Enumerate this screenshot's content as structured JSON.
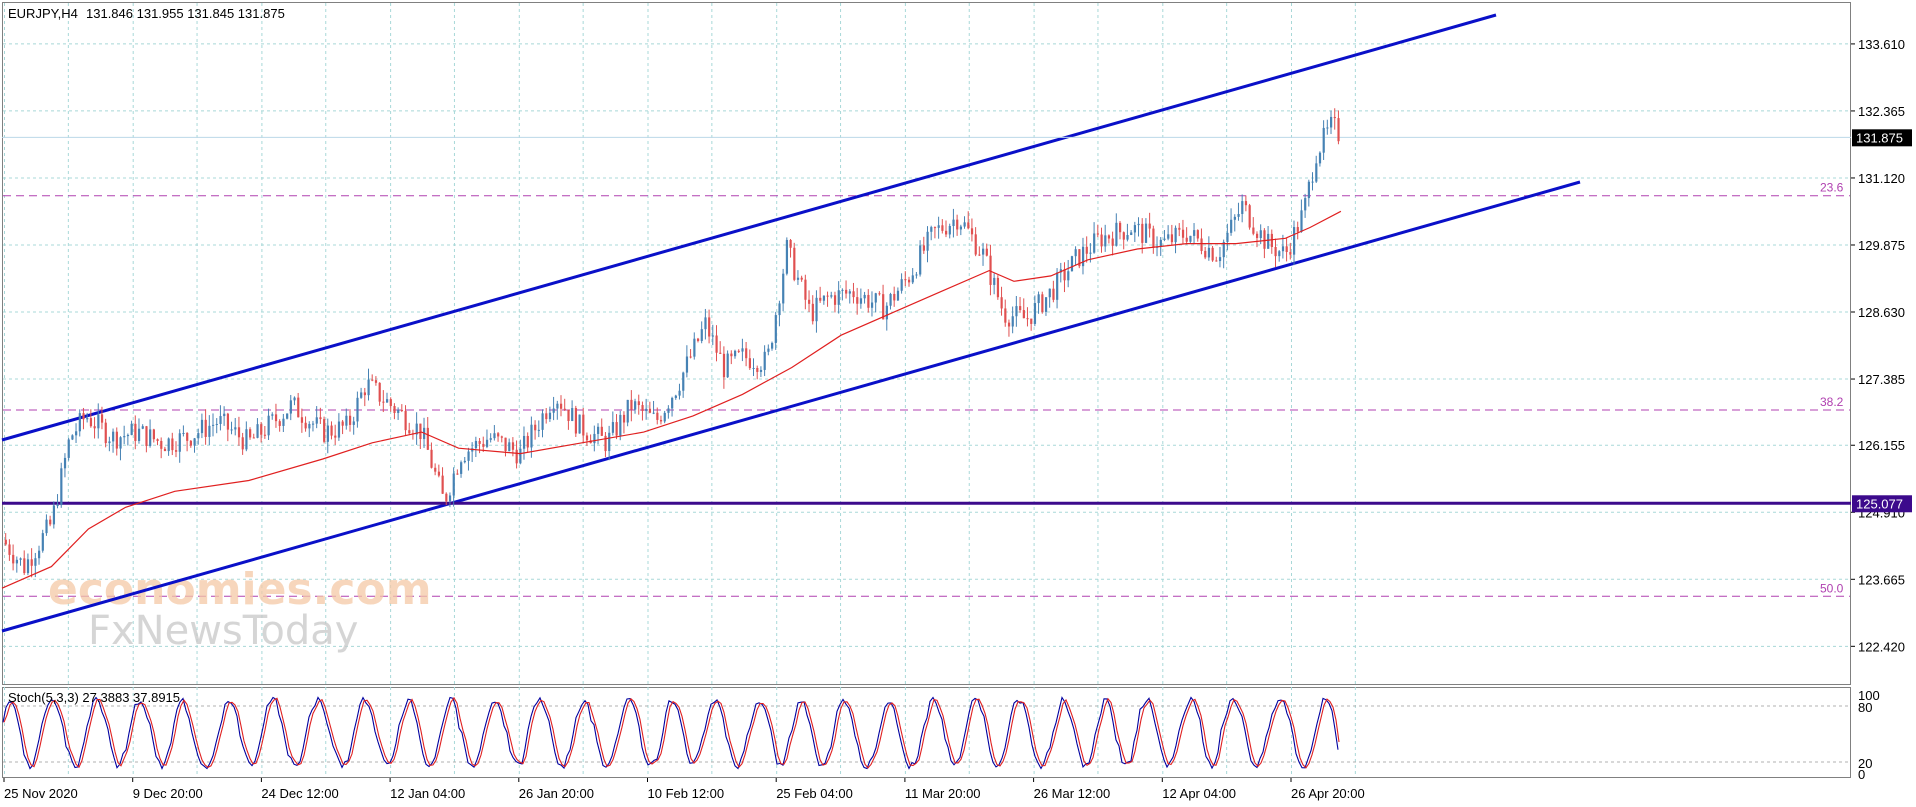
{
  "header": {
    "symbol": "EURJPY,H4",
    "ohlc": "131.846 131.955 131.845 131.875"
  },
  "indicator": {
    "label": "Stoch(5,3,3) 27.3883 37.8915",
    "levels": [
      "100",
      "80",
      "20",
      "0"
    ]
  },
  "watermark": {
    "line1": "economies.com",
    "line2": "FxNewsToday"
  },
  "colors": {
    "bull": "#4682b4",
    "bear": "#e05050",
    "ma": "#e02020",
    "channel": "#0a10c8",
    "support": "#3c0a8c",
    "fib": "#b040b0",
    "grid": "#a8d8d8",
    "stoch_main": "#0000a0",
    "stoch_signal": "#e02020"
  },
  "chart_data": {
    "type": "candlestick",
    "symbol": "EURJPY",
    "timeframe": "H4",
    "price_axis_ticks": [
      "133.610",
      "132.365",
      "131.120",
      "129.875",
      "128.630",
      "127.385",
      "126.155",
      "124.910",
      "123.665",
      "122.420"
    ],
    "ylim": [
      121.72,
      134.37
    ],
    "last_price": "131.875",
    "support_line": {
      "price": 125.077,
      "label": "125.077"
    },
    "fib_levels": [
      {
        "label": "23.6",
        "price": 130.79
      },
      {
        "label": "38.2",
        "price": 126.81
      },
      {
        "label": "50.0",
        "price": 123.35
      }
    ],
    "time_labels": [
      "25 Nov 2020",
      "9 Dec 20:00",
      "24 Dec 12:00",
      "12 Jan 04:00",
      "26 Jan 20:00",
      "10 Feb 12:00",
      "25 Feb 04:00",
      "11 Mar 20:00",
      "26 Mar 12:00",
      "12 Apr 04:00",
      "26 Apr 20:00"
    ],
    "price_path": [
      [
        0,
        124.4
      ],
      [
        18,
        123.9
      ],
      [
        40,
        124.7
      ],
      [
        55,
        126.3
      ],
      [
        68,
        126.7
      ],
      [
        90,
        126.3
      ],
      [
        110,
        126.4
      ],
      [
        130,
        126.2
      ],
      [
        150,
        126.3
      ],
      [
        175,
        126.6
      ],
      [
        200,
        126.2
      ],
      [
        235,
        126.9
      ],
      [
        260,
        126.4
      ],
      [
        280,
        126.5
      ],
      [
        295,
        127.3
      ],
      [
        320,
        126.8
      ],
      [
        340,
        126.4
      ],
      [
        358,
        125.1
      ],
      [
        372,
        126.0
      ],
      [
        395,
        126.3
      ],
      [
        420,
        126.0
      ],
      [
        448,
        127.1
      ],
      [
        468,
        126.5
      ],
      [
        490,
        126.2
      ],
      [
        510,
        126.9
      ],
      [
        530,
        126.6
      ],
      [
        548,
        127.3
      ],
      [
        570,
        128.4
      ],
      [
        585,
        127.6
      ],
      [
        600,
        127.8
      ],
      [
        620,
        127.7
      ],
      [
        636,
        129.8
      ],
      [
        655,
        128.6
      ],
      [
        670,
        128.9
      ],
      [
        690,
        129.0
      ],
      [
        715,
        128.7
      ],
      [
        735,
        129.3
      ],
      [
        755,
        130.1
      ],
      [
        775,
        130.4
      ],
      [
        795,
        129.7
      ],
      [
        812,
        128.6
      ],
      [
        830,
        128.5
      ],
      [
        850,
        129.0
      ],
      [
        870,
        129.6
      ],
      [
        890,
        130.0
      ],
      [
        915,
        130.2
      ],
      [
        940,
        129.9
      ],
      [
        960,
        130.1
      ],
      [
        985,
        129.7
      ],
      [
        1005,
        130.6
      ],
      [
        1025,
        129.9
      ],
      [
        1040,
        129.7
      ],
      [
        1055,
        130.5
      ],
      [
        1065,
        131.6
      ],
      [
        1078,
        132.1
      ],
      [
        1085,
        131.88
      ]
    ],
    "moving_average_path": [
      [
        0,
        123.5
      ],
      [
        40,
        123.9
      ],
      [
        70,
        124.6
      ],
      [
        100,
        125.0
      ],
      [
        140,
        125.3
      ],
      [
        200,
        125.5
      ],
      [
        260,
        125.9
      ],
      [
        300,
        126.2
      ],
      [
        340,
        126.4
      ],
      [
        370,
        126.1
      ],
      [
        420,
        126.0
      ],
      [
        470,
        126.2
      ],
      [
        520,
        126.4
      ],
      [
        560,
        126.7
      ],
      [
        600,
        127.1
      ],
      [
        640,
        127.6
      ],
      [
        680,
        128.2
      ],
      [
        720,
        128.6
      ],
      [
        760,
        129.0
      ],
      [
        800,
        129.4
      ],
      [
        820,
        129.2
      ],
      [
        850,
        129.3
      ],
      [
        880,
        129.6
      ],
      [
        920,
        129.8
      ],
      [
        960,
        129.9
      ],
      [
        1000,
        129.9
      ],
      [
        1040,
        130.0
      ],
      [
        1060,
        130.2
      ],
      [
        1085,
        130.5
      ]
    ],
    "stochastic": {
      "main": 27.3883,
      "signal": 37.8915,
      "levels": [
        100,
        80,
        20,
        0
      ]
    }
  }
}
